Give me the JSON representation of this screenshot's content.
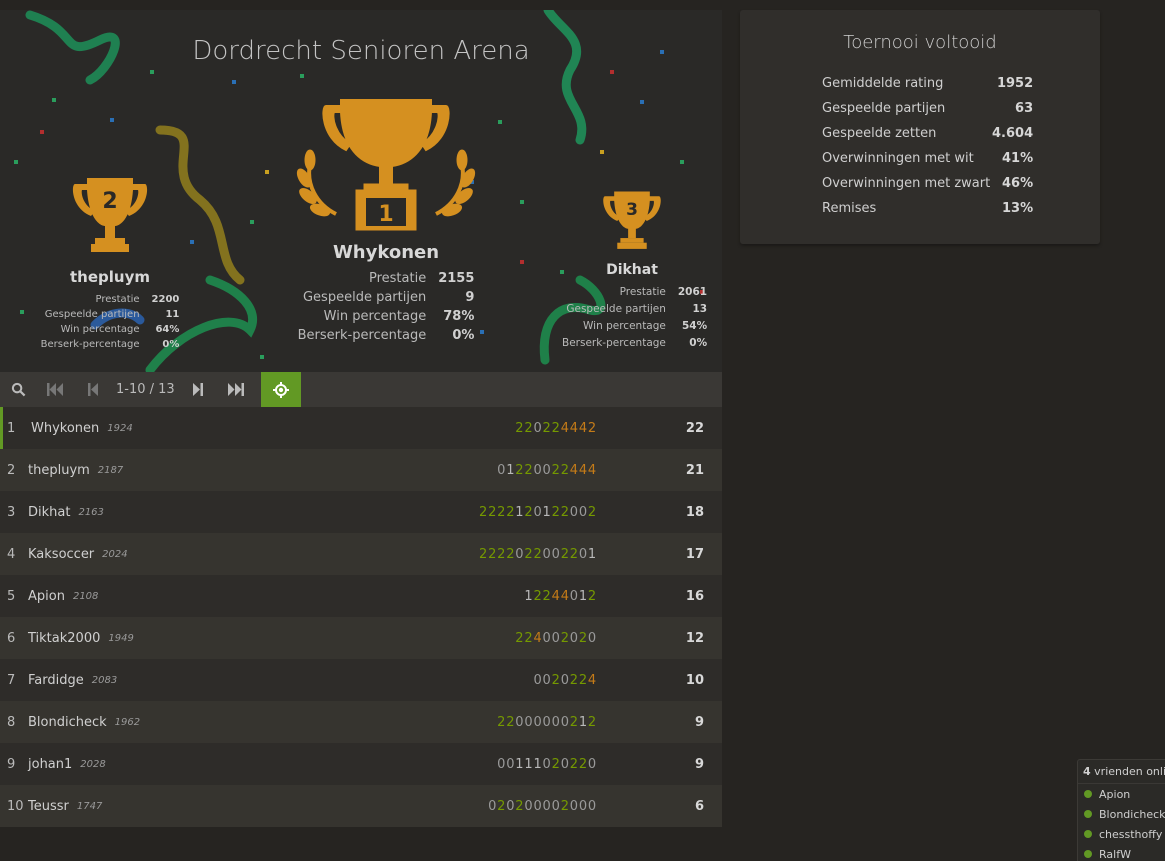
{
  "tournament": {
    "title": "Dordrecht Senioren Arena"
  },
  "podium": {
    "first": {
      "rank_numeral": "1",
      "name": "Whykonen",
      "stats": [
        {
          "label": "Prestatie",
          "value": "2155"
        },
        {
          "label": "Gespeelde partijen",
          "value": "9"
        },
        {
          "label": "Win percentage",
          "value": "78%"
        },
        {
          "label": "Berserk-percentage",
          "value": "0%"
        }
      ]
    },
    "second": {
      "rank_numeral": "2",
      "name": "thepluym",
      "stats": [
        {
          "label": "Prestatie",
          "value": "2200"
        },
        {
          "label": "Gespeelde partijen",
          "value": "11"
        },
        {
          "label": "Win percentage",
          "value": "64%"
        },
        {
          "label": "Berserk-percentage",
          "value": "0%"
        }
      ]
    },
    "third": {
      "rank_numeral": "3",
      "name": "Dikhat",
      "stats": [
        {
          "label": "Prestatie",
          "value": "2061"
        },
        {
          "label": "Gespeelde partijen",
          "value": "13"
        },
        {
          "label": "Win percentage",
          "value": "54%"
        },
        {
          "label": "Berserk-percentage",
          "value": "0%"
        }
      ]
    }
  },
  "pager": {
    "label": "1-10 / 13",
    "icons": [
      "search-icon",
      "first-page-icon",
      "prev-page-icon",
      "next-page-icon",
      "last-page-icon",
      "my-position-icon"
    ]
  },
  "standings": [
    {
      "rank": "1",
      "name": "Whykonen",
      "rating": "1924",
      "sheet": "220224442",
      "total": "22"
    },
    {
      "rank": "2",
      "name": "thepluym",
      "rating": "2187",
      "sheet": "01220022444",
      "total": "21"
    },
    {
      "rank": "3",
      "name": "Dikhat",
      "rating": "2163",
      "sheet": "2222120122002",
      "total": "18"
    },
    {
      "rank": "4",
      "name": "Kaksoccer",
      "rating": "2024",
      "sheet": "222202200220 1",
      "total": "17"
    },
    {
      "rank": "5",
      "name": "Apion",
      "rating": "2108",
      "sheet": "12244012",
      "total": "16"
    },
    {
      "rank": "6",
      "name": "Tiktak2000",
      "rating": "1949",
      "sheet": "224002020",
      "total": "12"
    },
    {
      "rank": "7",
      "name": "Fardidge",
      "rating": "2083",
      "sheet": "0020224",
      "total": "10"
    },
    {
      "rank": "8",
      "name": "Blondicheck",
      "rating": "1962",
      "sheet": "22000000212",
      "total": "9"
    },
    {
      "rank": "9",
      "name": "johan1",
      "rating": "2028",
      "sheet": "00111020220",
      "total": "9"
    },
    {
      "rank": "10",
      "name": "Teussr",
      "rating": "1747",
      "sheet": "020200002000",
      "total": "6"
    }
  ],
  "summary": {
    "title": "Toernooi voltooid",
    "stats": [
      {
        "label": "Gemiddelde rating",
        "value": "1952"
      },
      {
        "label": "Gespeelde partijen",
        "value": "63"
      },
      {
        "label": "Gespeelde zetten",
        "value": "4.604"
      },
      {
        "label": "Overwinningen met wit",
        "value": "41%"
      },
      {
        "label": "Overwinningen met zwart",
        "value": "46%"
      },
      {
        "label": "Remises",
        "value": "13%"
      }
    ]
  },
  "friends": {
    "count": "4",
    "label": "vrienden online",
    "names": [
      "Apion",
      "Blondicheck",
      "chessthoffy",
      "RalfW"
    ]
  },
  "colors": {
    "accent": "#629924",
    "trophy": "#d59020",
    "win": "#759900",
    "streak": "#c47b18"
  }
}
